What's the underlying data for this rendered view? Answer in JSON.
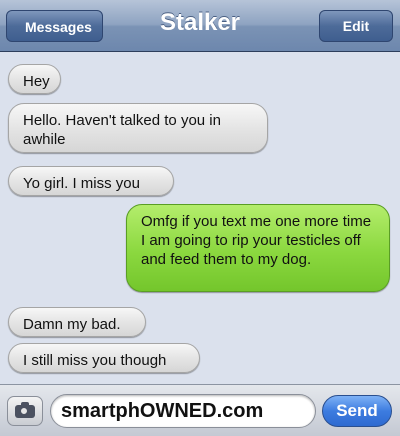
{
  "header": {
    "title": "Stalker",
    "back_label": "Messages",
    "edit_label": "Edit"
  },
  "messages": [
    {
      "direction": "incoming",
      "text": "Hey"
    },
    {
      "direction": "incoming",
      "text": "Hello. Haven't talked to you in awhile"
    },
    {
      "direction": "incoming",
      "text": "Yo girl. I miss you"
    },
    {
      "direction": "outgoing",
      "text": "Omfg if you text me one more time I am going to rip your testicles off and feed them to my dog."
    },
    {
      "direction": "incoming",
      "text": "Damn my bad."
    },
    {
      "direction": "incoming",
      "text": "I still miss you though"
    }
  ],
  "input_bar": {
    "field_value": "smartphOWNED.com",
    "send_label": "Send",
    "camera_icon": "camera-icon"
  },
  "colors": {
    "outgoing_bubble": "#8bd83f",
    "incoming_bubble": "#e3e3e3",
    "navbar": "#8ea3c1",
    "send_button": "#3d7ce0"
  }
}
